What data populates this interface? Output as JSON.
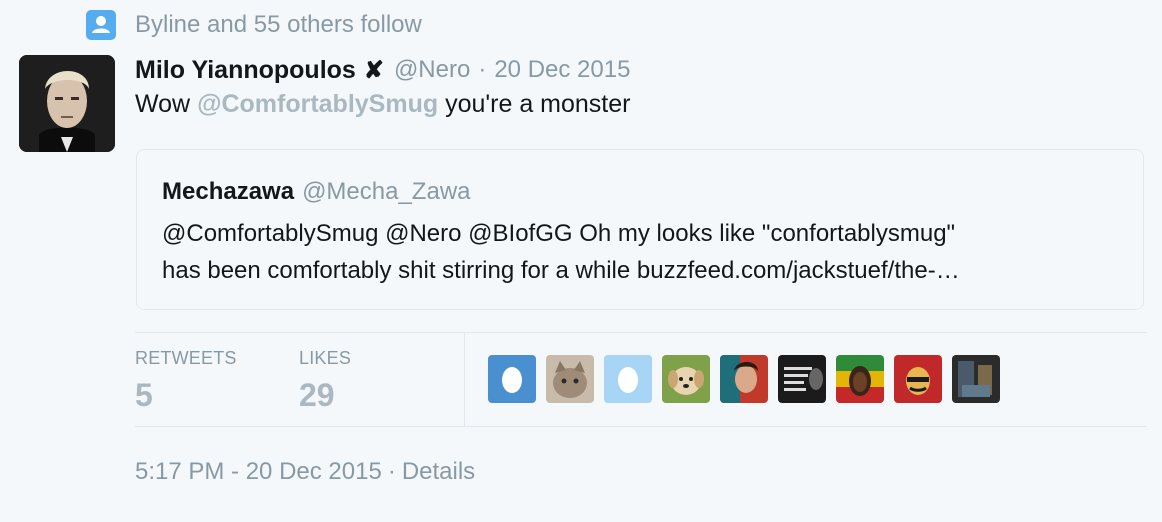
{
  "follow_context": {
    "icon": "person-icon",
    "text": "Byline and 55 others follow"
  },
  "tweet": {
    "fullname": "Milo Yiannopoulos",
    "badge": "✘",
    "username": "@Nero",
    "separator": "·",
    "date": "20 Dec 2015",
    "text_before": "Wow ",
    "mention": "@ComfortablySmug",
    "text_after": " you're a monster"
  },
  "quote": {
    "name": "Mechazawa",
    "username": "@Mecha_Zawa",
    "line1": "@ComfortablySmug @Nero @BIofGG Oh my looks like \"confortablysmug\"",
    "line2": "has been comfortably shit stirring for a while buzzfeed.com/jackstuef/the-…"
  },
  "stats": {
    "retweets_label": "RETWEETS",
    "retweets_count": "5",
    "likes_label": "LIKES",
    "likes_count": "29"
  },
  "likers": [
    {
      "name": "egg-avatar-blue",
      "color": "#4a90d0"
    },
    {
      "name": "cat-avatar",
      "color": "#b8a48e"
    },
    {
      "name": "egg-avatar-lightblue",
      "color": "#a8d4f5"
    },
    {
      "name": "puppy-avatar",
      "color": "#8fae5a"
    },
    {
      "name": "portrait-avatar-red",
      "color": "#c0392b"
    },
    {
      "name": "keiner-kommt-klar-avatar",
      "color": "#1b1b1b"
    },
    {
      "name": "bob-marley-avatar",
      "color": "#d4a017"
    },
    {
      "name": "stalin-poster-avatar",
      "color": "#c0282a"
    },
    {
      "name": "photo-avatar-dark",
      "color": "#2b2b2b"
    }
  ],
  "footer": {
    "time": "5:17 PM - 20 Dec 2015",
    "separator": "·",
    "details": "Details"
  }
}
